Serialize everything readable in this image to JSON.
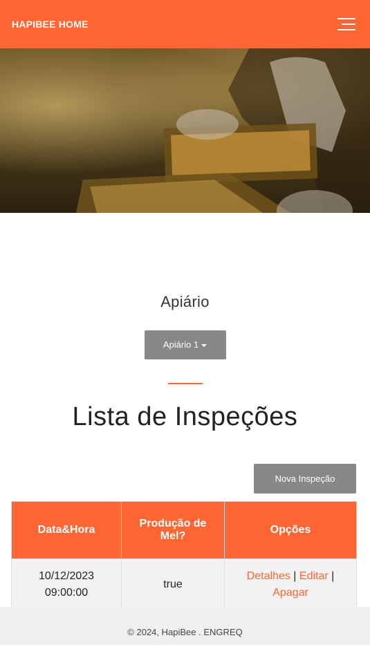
{
  "navbar": {
    "brand": "HAPIBEE HOME",
    "menu_icon": "hamburger-icon",
    "accent": "#ff6633"
  },
  "apiario": {
    "title": "Apiário",
    "selected": "Apiário 1"
  },
  "lista": {
    "title": "Lista de Inspeções",
    "nova_label": "Nova Inspeção"
  },
  "table": {
    "headers": [
      "Data&Hora",
      "Produção de Mel?",
      "Opções"
    ],
    "rows": [
      {
        "date": "10/12/2023",
        "time": "09:00:00",
        "mel": "true",
        "detalhes": "Detalhes",
        "editar": "Editar",
        "apagar": "Apagar"
      }
    ]
  },
  "footer": {
    "text": "© 2024, HapiBee . ENGREQ"
  }
}
